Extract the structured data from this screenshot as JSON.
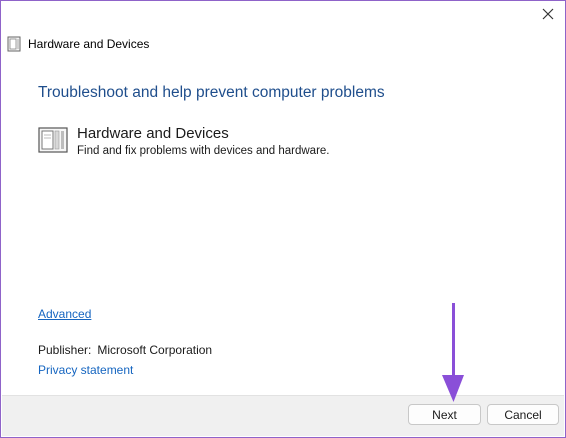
{
  "window": {
    "title": "Hardware and Devices",
    "close_icon": "close-icon",
    "title_icon": "troubleshooter-icon"
  },
  "main": {
    "heading": "Troubleshoot and help prevent computer problems",
    "item": {
      "title": "Hardware and Devices",
      "description": "Find and fix problems with devices and hardware.",
      "icon": "hardware-devices-icon"
    },
    "advanced_link": "Advanced",
    "publisher_label": "Publisher:",
    "publisher_value": "Microsoft Corporation",
    "privacy_link": "Privacy statement"
  },
  "footer": {
    "next_label": "Next",
    "cancel_label": "Cancel"
  },
  "annotation": {
    "arrow_color": "#8a4fd8",
    "frame_color": "#8f63c9",
    "heading_color": "#1f4e8c",
    "link_color": "#1565c0"
  }
}
